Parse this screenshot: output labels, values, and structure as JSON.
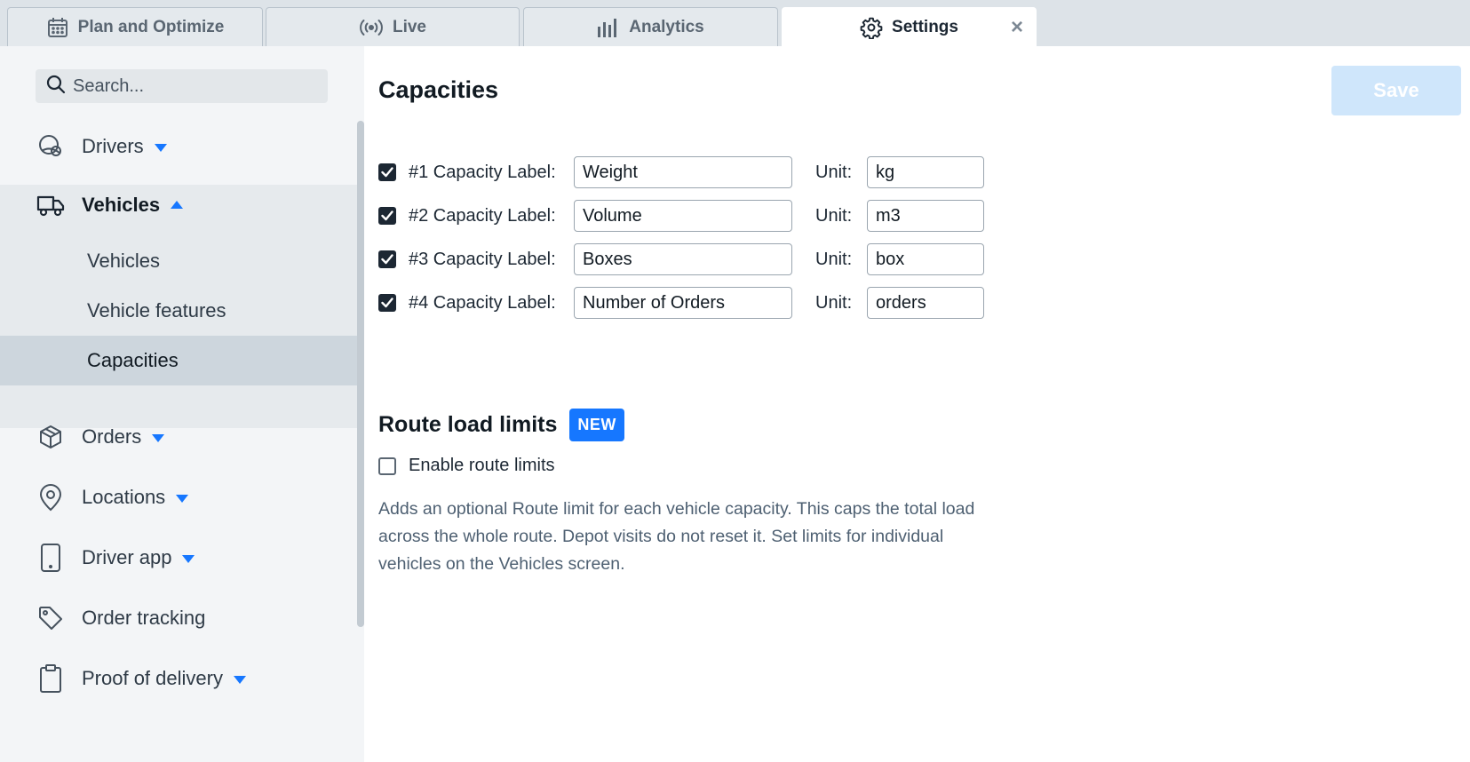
{
  "tabs": [
    {
      "label": "Plan and Optimize",
      "icon": "calendar-icon",
      "active": false
    },
    {
      "label": "Live",
      "icon": "broadcast-icon",
      "active": false
    },
    {
      "label": "Analytics",
      "icon": "bar-chart-icon",
      "active": false
    },
    {
      "label": "Settings",
      "icon": "gear-icon",
      "active": true,
      "close_label": "×"
    }
  ],
  "sidebar": {
    "search_placeholder": "Search...",
    "items": [
      {
        "label": "Drivers",
        "icon": "steering-wheel-icon",
        "expanded": false
      },
      {
        "label": "Vehicles",
        "icon": "truck-icon",
        "expanded": true,
        "children": [
          "Vehicles",
          "Vehicle features",
          "Capacities"
        ],
        "selected_child": "Capacities"
      },
      {
        "label": "Orders",
        "icon": "package-icon",
        "expanded": false
      },
      {
        "label": "Locations",
        "icon": "location-pin-icon",
        "expanded": false
      },
      {
        "label": "Driver app",
        "icon": "phone-icon",
        "expanded": false
      },
      {
        "label": "Order tracking",
        "icon": "tag-icon",
        "expanded": null
      },
      {
        "label": "Proof of delivery",
        "icon": "clipboard-icon",
        "expanded": false
      }
    ]
  },
  "main": {
    "title": "Capacities",
    "save_label": "Save",
    "unit_text": "Unit:",
    "capacities": [
      {
        "label": "#1 Capacity Label:",
        "value": "Weight",
        "unit": "kg",
        "checked": true
      },
      {
        "label": "#2 Capacity Label:",
        "value": "Volume",
        "unit": "m3",
        "checked": true
      },
      {
        "label": "#3 Capacity Label:",
        "value": "Boxes",
        "unit": "box",
        "checked": true
      },
      {
        "label": "#4 Capacity Label:",
        "value": "Number of Orders",
        "unit": "orders",
        "checked": true
      }
    ],
    "route_limits": {
      "title": "Route load limits",
      "badge": "NEW",
      "checkbox_label": "Enable route limits",
      "checked": false,
      "description": "Adds an optional Route limit for each vehicle capacity. This caps the total load across the whole route. Depot visits do not reset it. Set limits for individual vehicles on the Vehicles screen."
    }
  },
  "colors": {
    "accent": "#1677ff",
    "save_disabled": "#cfe6fb",
    "sidebar_bg": "#f3f5f7",
    "selected_bg": "#cdd6dd"
  }
}
